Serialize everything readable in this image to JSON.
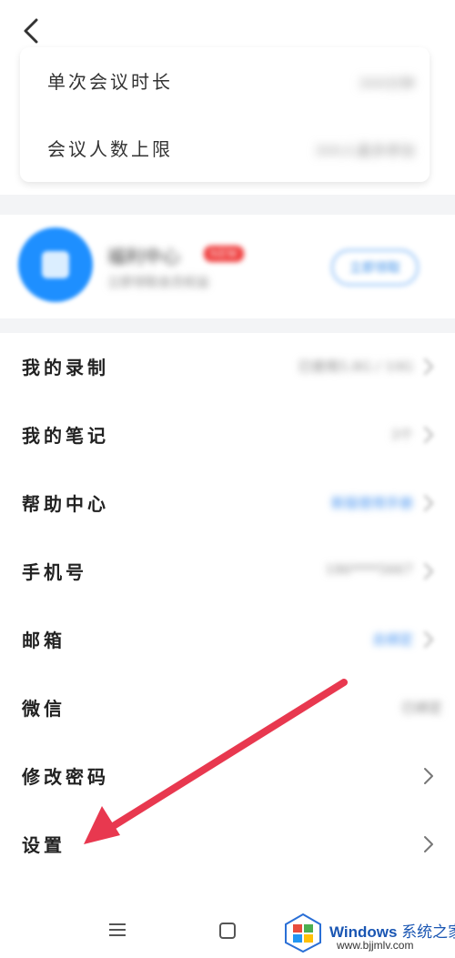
{
  "limits": [
    {
      "label": "单次会议时长",
      "value": "300分钟"
    },
    {
      "label": "会议人数上限",
      "value": "300人最多参加"
    }
  ],
  "promo": {
    "title": "福利中心",
    "badge": "NEW",
    "subtitle": "立即领取会员权益",
    "button": "立即领取"
  },
  "settings_rows": [
    {
      "label": "我的录制",
      "value": "已使用5.8G / 10G",
      "value_style": "grey",
      "chevron_faded": true
    },
    {
      "label": "我的笔记",
      "value": "3个",
      "value_style": "grey",
      "chevron_faded": true
    },
    {
      "label": "帮助中心",
      "value": "新版使用手册",
      "value_style": "blue",
      "chevron_faded": true
    },
    {
      "label": "手机号",
      "value": "186****5667",
      "value_style": "grey",
      "chevron_faded": true
    },
    {
      "label": "邮箱",
      "value": "去绑定",
      "value_style": "blue",
      "chevron_faded": true
    },
    {
      "label": "微信",
      "value": "已绑定",
      "value_style": "grey",
      "chevron_faded": false,
      "no_chevron": true
    },
    {
      "label": "修改密码",
      "value": "",
      "value_style": "grey",
      "chevron_faded": false
    },
    {
      "label": "设置",
      "value": "",
      "value_style": "grey",
      "chevron_faded": false
    }
  ],
  "icons": {
    "back": "chevron-left-icon",
    "nav_menu": "menu-icon",
    "nav_home": "square-icon"
  },
  "colors": {
    "annotation_arrow": "#e8384f",
    "accent_blue": "#3f8ff0"
  },
  "watermark": {
    "brand": "Windows",
    "suffix": "系统之家",
    "url": "www.bjjmlv.com"
  }
}
